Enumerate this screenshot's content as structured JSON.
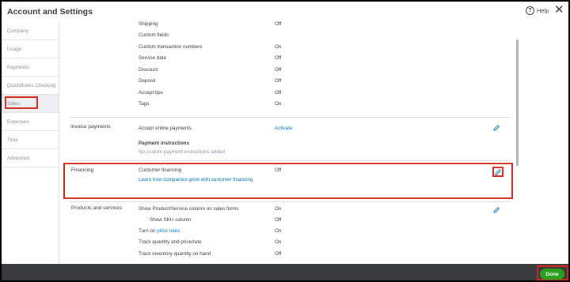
{
  "window": {
    "title": "Account and Settings",
    "help_label": "Help"
  },
  "sidebar": {
    "items": [
      {
        "label": "Company"
      },
      {
        "label": "Usage"
      },
      {
        "label": "Payments"
      },
      {
        "label": "QuickBooks Checking"
      },
      {
        "label": "Sales"
      },
      {
        "label": "Expenses"
      },
      {
        "label": "Time"
      },
      {
        "label": "Advanced"
      }
    ],
    "active": "Sales"
  },
  "sales_form_content": {
    "rows": [
      {
        "label": "Shipping",
        "value": "Off"
      },
      {
        "label": "Custom fields",
        "value": ""
      },
      {
        "label": "Custom transaction numbers",
        "value": "On"
      },
      {
        "label": "Service date",
        "value": "Off"
      },
      {
        "label": "Discount",
        "value": "Off"
      },
      {
        "label": "Deposit",
        "value": "Off"
      },
      {
        "label": "Accept tips",
        "value": "Off"
      },
      {
        "label": "Tags",
        "value": "On"
      }
    ]
  },
  "invoice_payments": {
    "section_label": "Invoice payments",
    "online_label": "Accept online payments",
    "online_action": "Activate",
    "instructions_label": "Payment instructions",
    "instructions_value": "No custom payment instructions added"
  },
  "financing": {
    "section_label": "Financing",
    "row_label": "Customer financing",
    "row_value": "Off",
    "link": "Learn how companies grow with customer financing"
  },
  "products_services": {
    "section_label": "Products and services",
    "rows": [
      {
        "label": "Show Product/Service column on sales forms",
        "value": "On"
      },
      {
        "label": "Show SKU column",
        "value": "Off"
      },
      {
        "label": "Turn on",
        "link": "price rules",
        "value": "On"
      },
      {
        "label": "Track quantity and price/rate",
        "value": "On"
      },
      {
        "label": "Track inventory quantity on hand",
        "value": "Off"
      }
    ]
  },
  "footer": {
    "done_label": "Done"
  },
  "colors": {
    "accent": "#0077c5",
    "done": "#2ca01c",
    "footer": "#393a3d",
    "highlight": "#d52b1e"
  }
}
